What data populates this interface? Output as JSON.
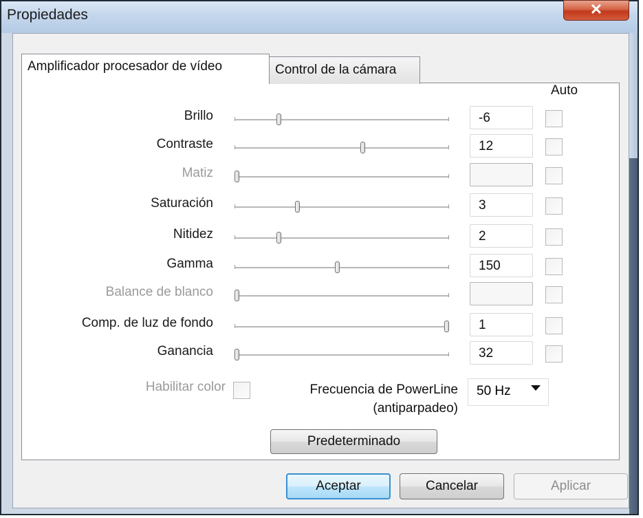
{
  "window": {
    "title": "Propiedades"
  },
  "tabs": [
    {
      "label": "Amplificador procesador de vídeo",
      "active": true
    },
    {
      "label": "Control de la cámara",
      "active": false
    }
  ],
  "auto_header": "Auto",
  "rows": [
    {
      "label": "Brillo",
      "value": "-6",
      "enabled": true,
      "slider_level": 0.2,
      "auto": false
    },
    {
      "label": "Contraste",
      "value": "12",
      "enabled": true,
      "slider_level": 0.6,
      "auto": false
    },
    {
      "label": "Matiz",
      "value": "",
      "enabled": false,
      "slider_level": 0.0,
      "auto": false
    },
    {
      "label": "Saturación",
      "value": "3",
      "enabled": true,
      "slider_level": 0.29,
      "auto": false
    },
    {
      "label": "Nitidez",
      "value": "2",
      "enabled": true,
      "slider_level": 0.2,
      "auto": false
    },
    {
      "label": "Gamma",
      "value": "150",
      "enabled": true,
      "slider_level": 0.48,
      "auto": false
    },
    {
      "label": "Balance de blanco",
      "value": "",
      "enabled": false,
      "slider_level": 0.0,
      "auto": false
    },
    {
      "label": "Comp. de luz de fondo",
      "value": "1",
      "enabled": true,
      "slider_level": 1.0,
      "auto": false
    },
    {
      "label": "Ganancia",
      "value": "32",
      "enabled": true,
      "slider_level": 0.0,
      "auto": false
    }
  ],
  "color_enable": {
    "label": "Habilitar color",
    "checked": false
  },
  "powerline": {
    "label_line1": "Frecuencia de PowerLine",
    "label_line2": "(antiparpadeo)",
    "selected": "50 Hz"
  },
  "buttons": {
    "default": "Predeterminado",
    "accept": "Aceptar",
    "cancel": "Cancelar",
    "apply": "Aplicar"
  },
  "icons": {
    "close": "close-icon",
    "dropdown": "chevron-down-icon"
  }
}
